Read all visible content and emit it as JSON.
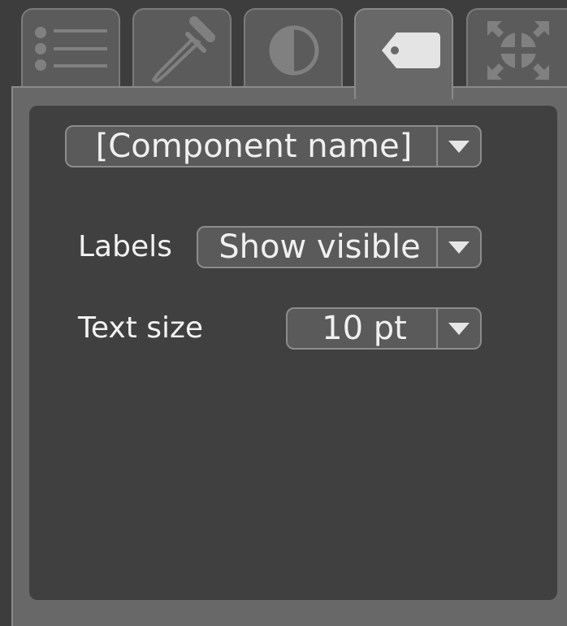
{
  "tabs": [
    {
      "name": "list",
      "icon": "list-icon",
      "active": false
    },
    {
      "name": "eyedropper",
      "icon": "eyedropper-icon",
      "active": false
    },
    {
      "name": "contrast",
      "icon": "contrast-icon",
      "active": false
    },
    {
      "name": "label",
      "icon": "tag-icon",
      "active": true
    },
    {
      "name": "fit",
      "icon": "fit-expand-icon",
      "active": false
    }
  ],
  "component_selector": {
    "value": "[Component name]"
  },
  "labels_field": {
    "label": "Labels",
    "value": "Show visible"
  },
  "text_size_field": {
    "label": "Text size",
    "value": "10 pt"
  },
  "colors": {
    "background": "#3d3d3d",
    "tab": "#5b5b5b",
    "active_tab": "#686868",
    "panel_inner": "#404040",
    "text": "#f0f0f0",
    "icon": "#808080"
  }
}
